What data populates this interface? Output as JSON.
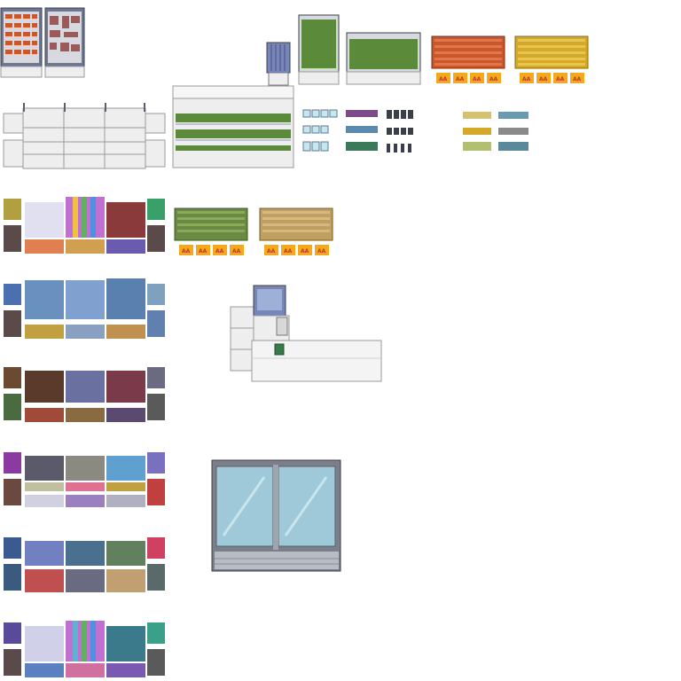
{
  "sheet": {
    "title": "",
    "background": "#ffffff"
  },
  "palette": {
    "outline": "#3b3f4a",
    "shelf_white": "#eeeeee",
    "shelf_shadow": "#c9c9c9",
    "fridge_frame": "#5a5f6b",
    "glass": "#9fc9d8",
    "glass_light": "#c8e6ee",
    "produce_green": "#5b8a3a",
    "bread_orange": "#c9572c",
    "cheese_yellow": "#d4a92a",
    "price_tag_bg": "#f4a81d",
    "price_tag_text": "#c0392b",
    "register_blue": "#7785b8"
  },
  "price_tag": {
    "label": "AA"
  },
  "tiles": [
    {
      "name": "meat-freezer-left"
    },
    {
      "name": "meat-freezer-right"
    },
    {
      "name": "ice-cream-display"
    },
    {
      "name": "produce-cooler-tall"
    },
    {
      "name": "produce-cooler-wide"
    },
    {
      "name": "bread-bin"
    },
    {
      "name": "cheese-bin"
    },
    {
      "name": "empty-shelf-unit"
    },
    {
      "name": "open-refrigerated-case"
    },
    {
      "name": "small-goods-set-1"
    },
    {
      "name": "small-goods-set-2"
    },
    {
      "name": "shelf-goods-row-1"
    },
    {
      "name": "vegetable-bin"
    },
    {
      "name": "potato-bin"
    },
    {
      "name": "shelf-goods-row-2"
    },
    {
      "name": "checkout-counter"
    },
    {
      "name": "shelf-goods-row-3"
    },
    {
      "name": "shelf-goods-row-4"
    },
    {
      "name": "double-door-fridge"
    },
    {
      "name": "shelf-goods-row-5"
    },
    {
      "name": "shelf-goods-row-6"
    }
  ]
}
